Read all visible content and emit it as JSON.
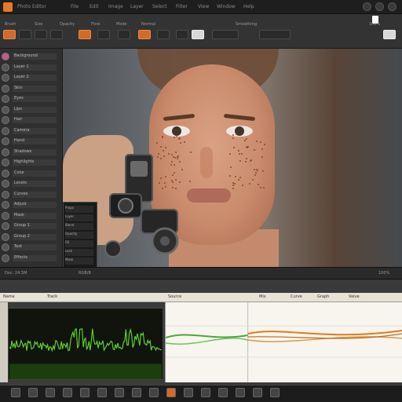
{
  "title_bar": {
    "title": "Photo Editor",
    "menu": [
      "File",
      "Edit",
      "Image",
      "Layer",
      "Select",
      "Filter",
      "View",
      "Window",
      "Help"
    ]
  },
  "toolbar": {
    "labels": [
      "Brush",
      "Size",
      "Opacity",
      "Flow",
      "Mode",
      "Normal",
      "Smoothing"
    ],
    "zoom": "100%"
  },
  "layers_panel": {
    "items": [
      "Background",
      "Layer 1",
      "Layer 2",
      "Skin",
      "Eyes",
      "Lips",
      "Hair",
      "Camera",
      "Hand",
      "Shadows",
      "Highlights",
      "Color",
      "Levels",
      "Curves",
      "Adjust",
      "Mask",
      "Group 1",
      "Group 2",
      "Text",
      "Effects"
    ]
  },
  "overlay_panel": {
    "rows": [
      "Props",
      "Layer",
      "Blend",
      "Opacity",
      "Fill",
      "Lock",
      "Mask"
    ]
  },
  "status_bar": {
    "left": "Doc: 24.5M",
    "mid": "RGB/8",
    "right": "100%"
  },
  "timeline": {
    "headers": [
      "Name",
      "Track",
      "Source",
      "Mix",
      "Curve",
      "Graph",
      "Value"
    ]
  },
  "colors": {
    "accent": "#e8772a",
    "waveform": "#5fd12a",
    "graph_green": "#4aa83a",
    "graph_orange": "#e07a1e"
  },
  "taskbar": {
    "icons": [
      "start-icon",
      "folder-icon",
      "browser-icon",
      "editor-icon",
      "photo-icon",
      "audio-icon",
      "terminal-icon",
      "settings-icon",
      "mail-icon",
      "chat-icon",
      "music-icon",
      "video-icon",
      "camera-icon",
      "notes-icon",
      "calendar-icon",
      "clock-icon"
    ]
  }
}
